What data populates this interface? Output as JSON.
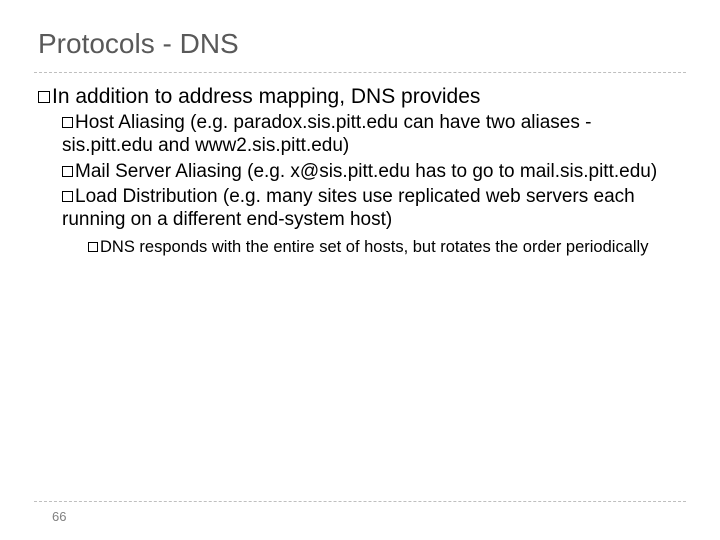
{
  "title": "Protocols - DNS",
  "l1": "In addition to address mapping, DNS provides",
  "l2a": "Host Aliasing (e.g. paradox.sis.pitt.edu can have two aliases - sis.pitt.edu and www2.sis.pitt.edu)",
  "l2b": "Mail Server Aliasing (e.g. x@sis.pitt.edu has to go to mail.sis.pitt.edu)",
  "l2c": "Load Distribution (e.g. many sites use replicated web servers each running on a different end-system host)",
  "l3a": "DNS responds with the entire set of hosts, but rotates the order periodically",
  "page": "66"
}
